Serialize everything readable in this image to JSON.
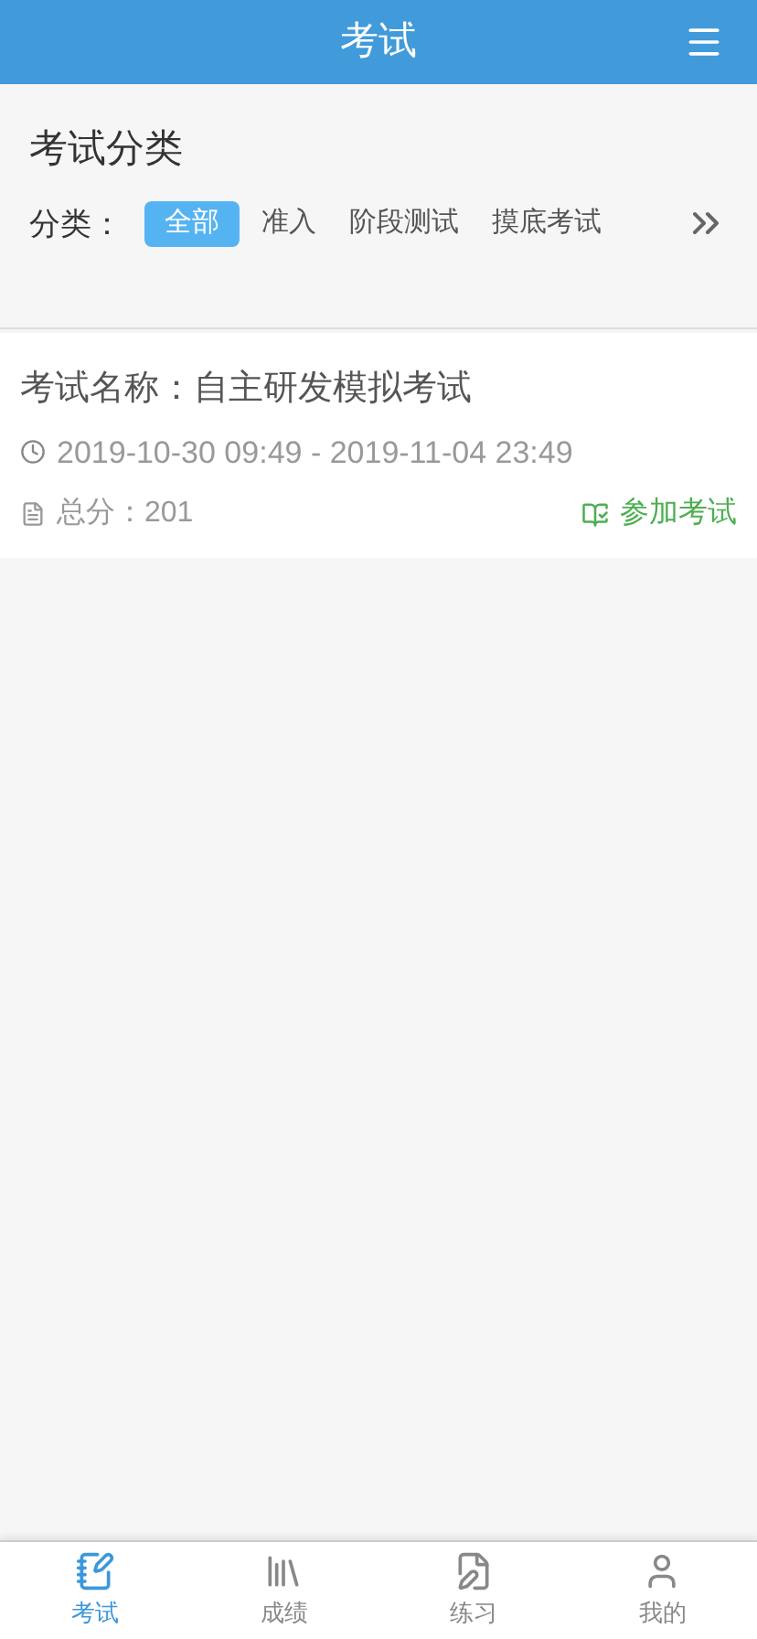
{
  "header": {
    "title": "考试"
  },
  "category": {
    "heading": "考试分类",
    "label": "分类：",
    "options": [
      {
        "label": "全部",
        "selected": true
      },
      {
        "label": "准入",
        "selected": false
      },
      {
        "label": "阶段测试",
        "selected": false
      },
      {
        "label": "摸底考试",
        "selected": false
      }
    ]
  },
  "exams": [
    {
      "name": "考试名称：自主研发模拟考试",
      "time": "2019-10-30 09:49 - 2019-11-04 23:49",
      "score": "总分：201",
      "action": "参加考试"
    }
  ],
  "tabbar": [
    {
      "kind": "exam",
      "label": "考试",
      "selected": true
    },
    {
      "kind": "scores",
      "label": "成绩",
      "selected": false
    },
    {
      "kind": "practice",
      "label": "练习",
      "selected": false
    },
    {
      "kind": "profile",
      "label": "我的",
      "selected": false
    }
  ]
}
